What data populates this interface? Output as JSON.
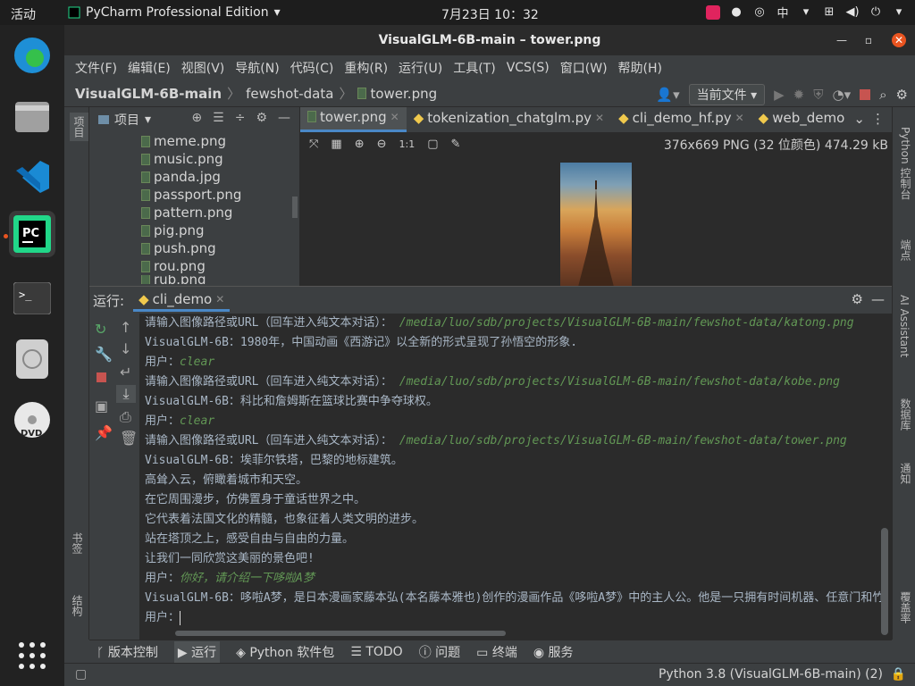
{
  "topbar": {
    "activities": "活动",
    "app_name": "PyCharm Professional Edition",
    "clock": "7月23日 10：32",
    "input_method": "中"
  },
  "window": {
    "title": "VisualGLM-6B-main – tower.png"
  },
  "menu": [
    "文件(F)",
    "编辑(E)",
    "视图(V)",
    "导航(N)",
    "代码(C)",
    "重构(R)",
    "运行(U)",
    "工具(T)",
    "VCS(S)",
    "窗口(W)",
    "帮助(H)"
  ],
  "breadcrumb": {
    "project": "VisualGLM-6B-main",
    "folder": "fewshot-data",
    "file": "tower.png"
  },
  "run_config": "当前文件",
  "left_strip": {
    "project": "项目",
    "bookmarks": "书签",
    "structure": "结构"
  },
  "right_strip": {
    "python_console": "Python 控制台",
    "endpoints": "端点",
    "ai_assistant": "AI Assistant",
    "database": "数据库",
    "notifications": "通知",
    "coverage": "覆盖率"
  },
  "project_panel": {
    "title": "项目",
    "files": [
      "meme.png",
      "music.png",
      "panda.jpg",
      "passport.png",
      "pattern.png",
      "pig.png",
      "push.png",
      "rou.png",
      "rub.png"
    ]
  },
  "editor_tabs": [
    {
      "label": "tower.png",
      "active": true
    },
    {
      "label": "tokenization_chatglm.py",
      "active": false
    },
    {
      "label": "cli_demo_hf.py",
      "active": false
    },
    {
      "label": "web_demo",
      "active": false
    }
  ],
  "image_info": "376x669 PNG (32 位颜色) 474.29 kB",
  "run_panel": {
    "label": "运行:",
    "tab": "cli_demo"
  },
  "console": [
    {
      "prompt": "请输入图像路径或URL（回车进入纯文本对话）：",
      "input": "/media/luo/sdb/projects/VisualGLM-6B-main/fewshot-data/katong.png"
    },
    {
      "text": "VisualGLM-6B：1980年，中国动画《西游记》以全新的形式呈现了孙悟空的形象."
    },
    {
      "prompt": "用户：",
      "input": "clear"
    },
    {
      "prompt": "请输入图像路径或URL（回车进入纯文本对话）：",
      "input": "/media/luo/sdb/projects/VisualGLM-6B-main/fewshot-data/kobe.png"
    },
    {
      "text": "VisualGLM-6B：科比和詹姆斯在篮球比赛中争夺球权。"
    },
    {
      "prompt": "用户：",
      "input": "clear"
    },
    {
      "prompt": "请输入图像路径或URL（回车进入纯文本对话）：",
      "input": "/media/luo/sdb/projects/VisualGLM-6B-main/fewshot-data/tower.png"
    },
    {
      "text": "VisualGLM-6B：埃菲尔铁塔，巴黎的地标建筑。"
    },
    {
      "text": "高耸入云，俯瞰着城市和天空。"
    },
    {
      "text": "在它周围漫步，仿佛置身于童话世界之中。"
    },
    {
      "text": "它代表着法国文化的精髓，也象征着人类文明的进步。"
    },
    {
      "text": "站在塔顶之上，感受自由与自由的力量。"
    },
    {
      "text": "让我们一同欣赏这美丽的景色吧!"
    },
    {
      "prompt": "用户：",
      "input": "你好，请介绍一下哆啦A梦"
    },
    {
      "text": "VisualGLM-6B：哆啦A梦，是日本漫画家藤本弘(本名藤本雅也)创作的漫画作品《哆啦A梦》中的主人公。他是一只拥有时间机器、任意门和竹"
    },
    {
      "prompt": "用户：",
      "input": ""
    }
  ],
  "tool_tabs": [
    "版本控制",
    "运行",
    "Python 软件包",
    "TODO",
    "问题",
    "终端",
    "服务"
  ],
  "status": {
    "interpreter": "Python 3.8 (VisualGLM-6B-main) (2)"
  }
}
